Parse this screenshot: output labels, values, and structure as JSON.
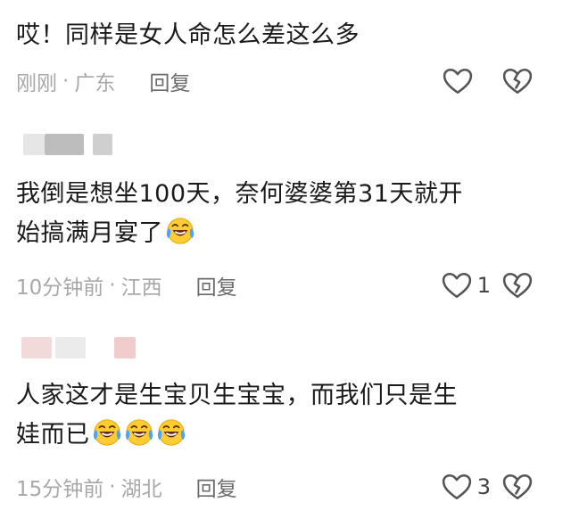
{
  "comments": [
    {
      "text": "哎！同样是女人命怎么差这么多",
      "time": "刚刚",
      "location": "广东",
      "reply_label": "回复",
      "likes": ""
    },
    {
      "text_line1": "我倒是想坐100天，奈何婆婆第31天就开",
      "text_line2": "始搞满月宴了",
      "time": "10分钟前",
      "location": "江西",
      "reply_label": "回复",
      "likes": "1"
    },
    {
      "text_line1": "人家这才是生宝贝生宝宝，而我们只是生",
      "text_line2": "娃而已",
      "time": "15分钟前",
      "location": "湖北",
      "reply_label": "回复",
      "likes": "3"
    }
  ],
  "meta_separator": "·",
  "icons": {
    "like": "heart-outline-icon",
    "dislike": "broken-heart-outline-icon",
    "emoji": "laughing-crying-emoji"
  },
  "colors": {
    "text": "#1a1a1a",
    "meta": "#a8a8a8",
    "icon": "#555555"
  }
}
